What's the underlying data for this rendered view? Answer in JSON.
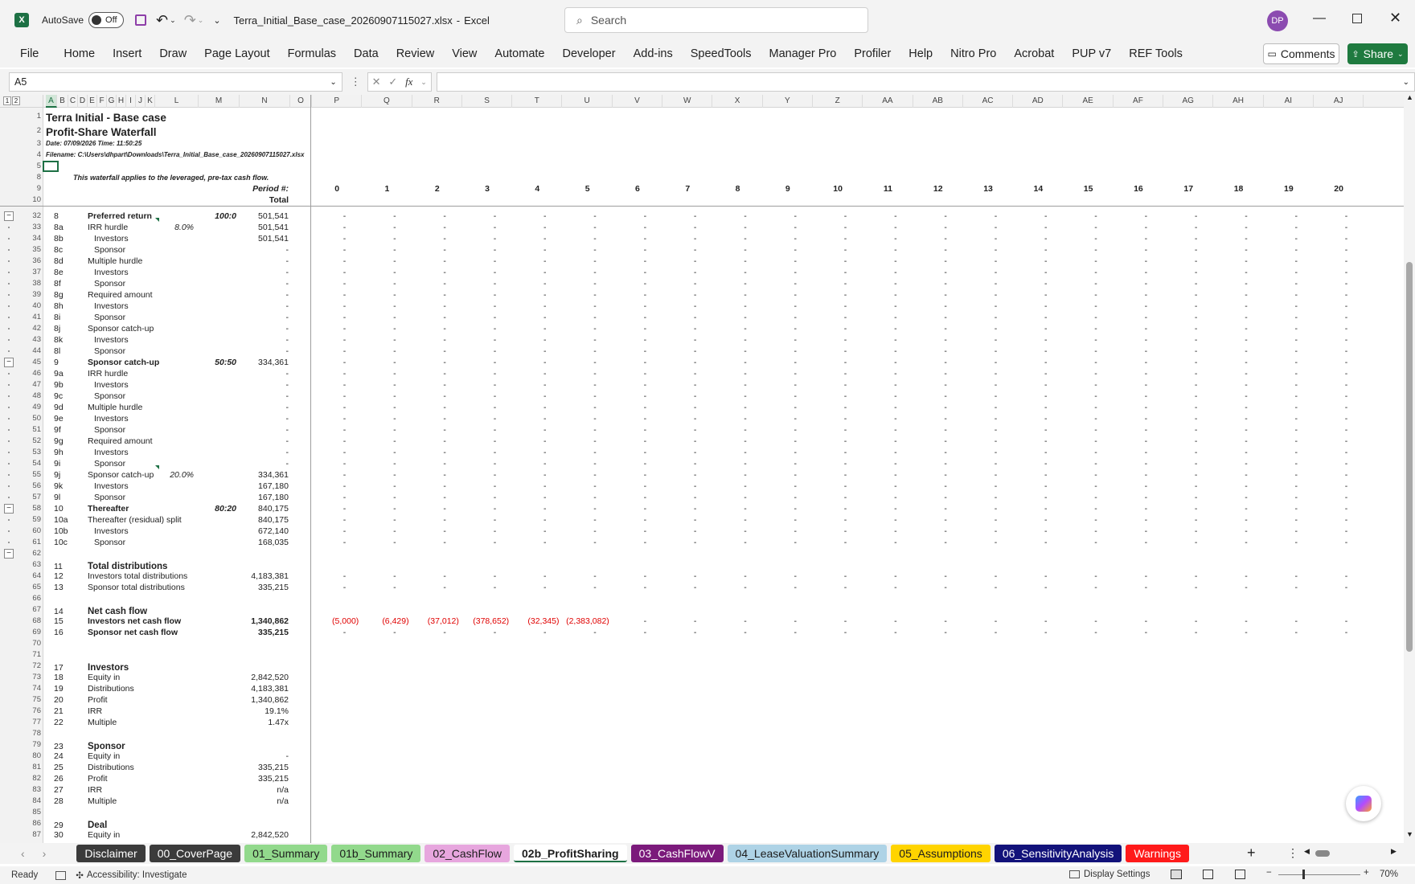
{
  "app": {
    "autosave_label": "AutoSave",
    "autosave_state": "Off",
    "doc_title": "Terra_Initial_Base_case_20260907115027.xlsx",
    "app_name": "Excel",
    "search_placeholder": "Search",
    "user_initials": "DP"
  },
  "menu": [
    "File",
    "Home",
    "Insert",
    "Draw",
    "Page Layout",
    "Formulas",
    "Data",
    "Review",
    "View",
    "Automate",
    "Developer",
    "Add-ins",
    "SpeedTools",
    "Manager Pro",
    "Profiler",
    "Help",
    "Nitro Pro",
    "Acrobat",
    "PUP v7",
    "REF Tools"
  ],
  "buttons": {
    "comments": "Comments",
    "share": "Share"
  },
  "formula": {
    "name_box": "A5",
    "fx": "fx",
    "content": ""
  },
  "outline_levels": [
    "1",
    "2"
  ],
  "columns": {
    "left": [
      "A",
      "B",
      "C",
      "D",
      "E",
      "F",
      "G",
      "H",
      "I",
      "J",
      "K",
      "L",
      "M",
      "N",
      "O",
      "P",
      "Q",
      "R",
      "S",
      "T",
      "U",
      "V",
      "W",
      "X",
      "Y",
      "Z",
      "AA",
      "AB",
      "AC",
      "AD",
      "AE",
      "AF",
      "AG",
      "AH",
      "AI",
      "AJ"
    ]
  },
  "header_rows": {
    "r1": {
      "num": "1",
      "text": "Terra Initial - Base case"
    },
    "r2": {
      "num": "2",
      "text": "Profit-Share Waterfall"
    },
    "r3": {
      "num": "3",
      "text": "Date: 07/09/2026  Time: 11:50:25"
    },
    "r4": {
      "num": "4",
      "text": "Filename: C:\\Users\\dhpart\\Downloads\\Terra_Initial_Base_case_20260907115027.xlsx"
    },
    "r5": {
      "num": "5"
    },
    "r8": {
      "num": "8",
      "text": "This waterfall applies to the leveraged, pre-tax cash flow."
    },
    "r9": {
      "num": "9",
      "text": "Period #:"
    },
    "r10": {
      "num": "10",
      "text": "Total"
    },
    "periods": [
      "0",
      "1",
      "2",
      "3",
      "4",
      "5",
      "6",
      "7",
      "8",
      "9",
      "10",
      "11",
      "12",
      "13",
      "14",
      "15",
      "16",
      "17",
      "18",
      "19",
      "20"
    ]
  },
  "rows": [
    {
      "num": "32",
      "id": "8",
      "label": "Preferred return",
      "b": true,
      "m": "100:0",
      "n": "501,541",
      "dash": true
    },
    {
      "num": "33",
      "id": "8a",
      "label": "IRR hurdle",
      "l": "8.0%",
      "n": "501,541",
      "dash": true
    },
    {
      "num": "34",
      "id": "8b",
      "label": "Investors",
      "ind": true,
      "n": "501,541",
      "dash": true
    },
    {
      "num": "35",
      "id": "8c",
      "label": "Sponsor",
      "ind": true,
      "n": "-",
      "dash": true
    },
    {
      "num": "36",
      "id": "8d",
      "label": "Multiple hurdle",
      "n": "-",
      "dash": true
    },
    {
      "num": "37",
      "id": "8e",
      "label": "Investors",
      "ind": true,
      "n": "-",
      "dash": true
    },
    {
      "num": "38",
      "id": "8f",
      "label": "Sponsor",
      "ind": true,
      "n": "-",
      "dash": true
    },
    {
      "num": "39",
      "id": "8g",
      "label": "Required amount",
      "n": "-",
      "dash": true
    },
    {
      "num": "40",
      "id": "8h",
      "label": "Investors",
      "ind": true,
      "n": "-",
      "dash": true
    },
    {
      "num": "41",
      "id": "8i",
      "label": "Sponsor",
      "ind": true,
      "n": "-",
      "dash": true
    },
    {
      "num": "42",
      "id": "8j",
      "label": "Sponsor catch-up",
      "n": "-",
      "dash": true
    },
    {
      "num": "43",
      "id": "8k",
      "label": "Investors",
      "ind": true,
      "n": "-",
      "dash": true
    },
    {
      "num": "44",
      "id": "8l",
      "label": "Sponsor",
      "ind": true,
      "n": "-",
      "dash": true
    },
    {
      "num": "45",
      "id": "9",
      "label": "Sponsor catch-up",
      "b": true,
      "m": "50:50",
      "n": "334,361",
      "dash": true
    },
    {
      "num": "46",
      "id": "9a",
      "label": "IRR hurdle",
      "n": "-",
      "dash": true
    },
    {
      "num": "47",
      "id": "9b",
      "label": "Investors",
      "ind": true,
      "n": "-",
      "dash": true
    },
    {
      "num": "48",
      "id": "9c",
      "label": "Sponsor",
      "ind": true,
      "n": "-",
      "dash": true
    },
    {
      "num": "49",
      "id": "9d",
      "label": "Multiple hurdle",
      "n": "-",
      "dash": true
    },
    {
      "num": "50",
      "id": "9e",
      "label": "Investors",
      "ind": true,
      "n": "-",
      "dash": true
    },
    {
      "num": "51",
      "id": "9f",
      "label": "Sponsor",
      "ind": true,
      "n": "-",
      "dash": true
    },
    {
      "num": "52",
      "id": "9g",
      "label": "Required amount",
      "n": "-",
      "dash": true
    },
    {
      "num": "53",
      "id": "9h",
      "label": "Investors",
      "ind": true,
      "n": "-",
      "dash": true
    },
    {
      "num": "54",
      "id": "9i",
      "label": "Sponsor",
      "ind": true,
      "n": "-",
      "dash": true
    },
    {
      "num": "55",
      "id": "9j",
      "label": "Sponsor catch-up",
      "l": "20.0%",
      "n": "334,361",
      "dash": true
    },
    {
      "num": "56",
      "id": "9k",
      "label": "Investors",
      "ind": true,
      "n": "167,180",
      "dash": true
    },
    {
      "num": "57",
      "id": "9l",
      "label": "Sponsor",
      "ind": true,
      "n": "167,180",
      "dash": true
    },
    {
      "num": "58",
      "id": "10",
      "label": "Thereafter",
      "b": true,
      "m": "80:20",
      "n": "840,175",
      "dash": true
    },
    {
      "num": "59",
      "id": "10a",
      "label": "Thereafter (residual) split",
      "n": "840,175",
      "dash": true
    },
    {
      "num": "60",
      "id": "10b",
      "label": "Investors",
      "ind": true,
      "n": "672,140",
      "dash": true
    },
    {
      "num": "61",
      "id": "10c",
      "label": "Sponsor",
      "ind": true,
      "n": "168,035",
      "dash": true
    },
    {
      "num": "62"
    },
    {
      "num": "63",
      "id": "11",
      "label": "Total distributions",
      "b": true,
      "big": true
    },
    {
      "num": "64",
      "id": "12",
      "label": "Investors total distributions",
      "n": "4,183,381",
      "dash": true
    },
    {
      "num": "65",
      "id": "13",
      "label": "Sponsor total distributions",
      "n": "335,215",
      "dash": true
    },
    {
      "num": "66"
    },
    {
      "num": "67",
      "id": "14",
      "label": "Net cash flow",
      "b": true,
      "big": true
    },
    {
      "num": "68",
      "id": "15",
      "label": "Investors net cash flow",
      "b": true,
      "n": "1,340,862",
      "nb": true,
      "dash": true,
      "red": [
        "(5,000)",
        "(6,429)",
        "(37,012)",
        "(378,652)",
        "(32,345)",
        "(2,383,082)"
      ]
    },
    {
      "num": "69",
      "id": "16",
      "label": "Sponsor net cash flow",
      "b": true,
      "n": "335,215",
      "nb": true,
      "dash": true
    },
    {
      "num": "70"
    },
    {
      "num": "71"
    },
    {
      "num": "72",
      "id": "17",
      "label": "Investors",
      "b": true,
      "big": true
    },
    {
      "num": "73",
      "id": "18",
      "label": "Equity in",
      "n": "2,842,520"
    },
    {
      "num": "74",
      "id": "19",
      "label": "Distributions",
      "n": "4,183,381"
    },
    {
      "num": "75",
      "id": "20",
      "label": "Profit",
      "n": "1,340,862"
    },
    {
      "num": "76",
      "id": "21",
      "label": "IRR",
      "n": "19.1%"
    },
    {
      "num": "77",
      "id": "22",
      "label": "Multiple",
      "n": "1.47x"
    },
    {
      "num": "78"
    },
    {
      "num": "79",
      "id": "23",
      "label": "Sponsor",
      "b": true,
      "big": true
    },
    {
      "num": "80",
      "id": "24",
      "label": "Equity in",
      "n": "-"
    },
    {
      "num": "81",
      "id": "25",
      "label": "Distributions",
      "n": "335,215"
    },
    {
      "num": "82",
      "id": "26",
      "label": "Profit",
      "n": "335,215"
    },
    {
      "num": "83",
      "id": "27",
      "label": "IRR",
      "n": "n/a"
    },
    {
      "num": "84",
      "id": "28",
      "label": "Multiple",
      "n": "n/a"
    },
    {
      "num": "85"
    },
    {
      "num": "86",
      "id": "29",
      "label": "Deal",
      "b": true,
      "big": true
    },
    {
      "num": "87",
      "id": "30",
      "label": "Equity in",
      "n": "2,842,520"
    }
  ],
  "tabs": [
    {
      "label": "Disclaimer",
      "bg": "#3b3b3b",
      "fg": "#ffffff"
    },
    {
      "label": "00_CoverPage",
      "bg": "#3b3b3b",
      "fg": "#ffffff"
    },
    {
      "label": "01_Summary",
      "bg": "#92d98c",
      "fg": "#1d1d1d"
    },
    {
      "label": "01b_Summary",
      "bg": "#92d98c",
      "fg": "#1d1d1d"
    },
    {
      "label": "02_CashFlow",
      "bg": "#e7a6de",
      "fg": "#1d1d1d"
    },
    {
      "label": "02b_ProfitSharing",
      "bg": "#ffffff",
      "fg": "#1d1d1d",
      "active": true
    },
    {
      "label": "03_CashFlowV",
      "bg": "#7b1a7b",
      "fg": "#ffffff"
    },
    {
      "label": "04_LeaseValuationSummary",
      "bg": "#aed3e6",
      "fg": "#1d1d1d"
    },
    {
      "label": "05_Assumptions",
      "bg": "#ffd400",
      "fg": "#1d1d1d"
    },
    {
      "label": "06_SensitivityAnalysis",
      "bg": "#12127a",
      "fg": "#ffffff"
    },
    {
      "label": "Warnings",
      "bg": "#ff1a1a",
      "fg": "#ffffff"
    }
  ],
  "status": {
    "ready": "Ready",
    "accessibility": "Accessibility: Investigate",
    "display_settings": "Display Settings",
    "zoom": "70%"
  },
  "colors": {
    "excel_green": "#1d7044",
    "share_green": "#1f7a3f",
    "avatar": "#8b4bb0"
  }
}
